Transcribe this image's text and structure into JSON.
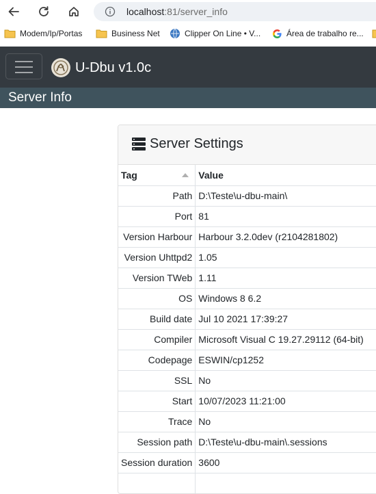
{
  "browser": {
    "url_host": "localhost",
    "url_path": ":81/server_info"
  },
  "bookmarks": [
    {
      "label": "Modem/Ip/Portas",
      "icon": "folder-icon"
    },
    {
      "label": "Business Net",
      "icon": "folder-icon"
    },
    {
      "label": "Clipper On Line • V...",
      "icon": "globe-icon"
    },
    {
      "label": "Área de trabalho re...",
      "icon": "google-icon"
    }
  ],
  "navbar": {
    "brand": "U-Dbu v1.0c"
  },
  "subheader": {
    "title": "Server Info"
  },
  "card": {
    "title": "Server Settings",
    "columns": [
      "Tag",
      "Value"
    ],
    "rows": [
      {
        "tag": "Path",
        "value": "D:\\Teste\\u-dbu-main\\"
      },
      {
        "tag": "Port",
        "value": "81"
      },
      {
        "tag": "Version Harbour",
        "value": "Harbour 3.2.0dev (r2104281802)"
      },
      {
        "tag": "Version Uhttpd2",
        "value": "1.05"
      },
      {
        "tag": "Version TWeb",
        "value": "1.11"
      },
      {
        "tag": "OS",
        "value": "Windows 8 6.2"
      },
      {
        "tag": "Build date",
        "value": "Jul 10 2021 17:39:27"
      },
      {
        "tag": "Compiler",
        "value": "Microsoft Visual C 19.27.29112 (64-bit)"
      },
      {
        "tag": "Codepage",
        "value": "ESWIN/cp1252"
      },
      {
        "tag": "SSL",
        "value": "No"
      },
      {
        "tag": "Start",
        "value": "10/07/2023 11:21:00"
      },
      {
        "tag": "Trace",
        "value": "No"
      },
      {
        "tag": "Session path",
        "value": "D:\\Teste\\u-dbu-main\\.sessions"
      },
      {
        "tag": "Session duration",
        "value": "3600"
      },
      {
        "tag": "",
        "value": ""
      }
    ]
  },
  "colors": {
    "navbar": "#343a40",
    "subheader": "#3f535d",
    "folder": "#f6c44f"
  }
}
